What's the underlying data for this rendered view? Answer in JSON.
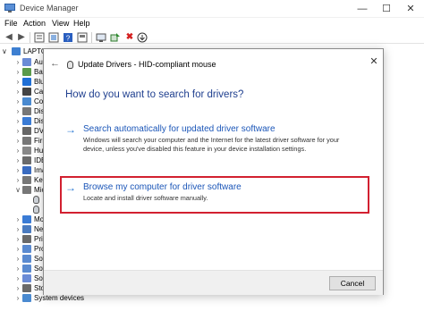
{
  "window": {
    "title": "Device Manager",
    "minimize_glyph": "—",
    "maximize_glyph": "☐",
    "close_glyph": "✕"
  },
  "menu": {
    "file": "File",
    "action": "Action",
    "view": "View",
    "help": "Help"
  },
  "toolbar": {
    "buttons": [
      "back-icon",
      "forward-icon",
      "properties-icon",
      "refresh-icon",
      "help-icon",
      "view-icon",
      "update-driver-icon",
      "uninstall-icon",
      "download-icon"
    ],
    "uninstall_color": "#d42020"
  },
  "tree": {
    "root_label": "LAPTO",
    "items": [
      {
        "label": "Aud",
        "icon": "audio-icon",
        "color": "#6a8bd6"
      },
      {
        "label": "Bat",
        "icon": "battery-icon",
        "color": "#5a9a4a"
      },
      {
        "label": "Blu",
        "icon": "bluetooth-icon",
        "color": "#1f6fd6"
      },
      {
        "label": "Can",
        "icon": "camera-icon",
        "color": "#444444"
      },
      {
        "label": "Con",
        "icon": "computer-icon",
        "color": "#4a8ad0"
      },
      {
        "label": "Dis",
        "icon": "disk-icon",
        "color": "#777777"
      },
      {
        "label": "Dis",
        "icon": "display-icon",
        "color": "#3a7bd5"
      },
      {
        "label": "DVI",
        "icon": "dvd-icon",
        "color": "#666666"
      },
      {
        "label": "Firm",
        "icon": "firmware-icon",
        "color": "#777777"
      },
      {
        "label": "Hu",
        "icon": "hid-icon",
        "color": "#888888"
      },
      {
        "label": "IDE",
        "icon": "ide-icon",
        "color": "#6b6b6b"
      },
      {
        "label": "Ima",
        "icon": "imaging-icon",
        "color": "#3a6bc0"
      },
      {
        "label": "Key",
        "icon": "keyboard-icon",
        "color": "#777777"
      },
      {
        "label": "Mic",
        "icon": "mouse-icon",
        "color": "#777777"
      },
      {
        "label": "",
        "icon": "mouse-child-icon",
        "color": "#cfd4da"
      },
      {
        "label": "",
        "icon": "mouse-child-icon",
        "color": "#cfd4da"
      },
      {
        "label": "Mo",
        "icon": "monitor-icon",
        "color": "#3a7bd5"
      },
      {
        "label": "Net",
        "icon": "network-icon",
        "color": "#4a7bc0"
      },
      {
        "label": "Pri",
        "icon": "print-icon",
        "color": "#6a6a6a"
      },
      {
        "label": "Pro",
        "icon": "processor-icon",
        "color": "#5a8ad0"
      },
      {
        "label": "Sof",
        "icon": "software-icon",
        "color": "#5a8ad0"
      },
      {
        "label": "Sof",
        "icon": "software-icon",
        "color": "#5a8ad0"
      },
      {
        "label": "Sou",
        "icon": "sound-icon",
        "color": "#6a8bd6"
      },
      {
        "label": "Sto",
        "icon": "storage-icon",
        "color": "#6a6a6a"
      },
      {
        "label": "System devices",
        "icon": "system-icon",
        "color": "#4a8ad0"
      }
    ]
  },
  "dialog": {
    "title": "Update Drivers - HID-compliant mouse",
    "back_glyph": "←",
    "close_glyph": "✕",
    "question": "How do you want to search for drivers?",
    "option1": {
      "title": "Search automatically for updated driver software",
      "description": "Windows will search your computer and the Internet for the latest driver software for your device, unless you've disabled this feature in your device installation settings."
    },
    "option2": {
      "title": "Browse my computer for driver software",
      "description": "Locate and install driver software manually."
    },
    "arrow_glyph": "→",
    "cancel_label": "Cancel",
    "highlight_color": "#d22030",
    "link_color": "#1b56b8"
  }
}
